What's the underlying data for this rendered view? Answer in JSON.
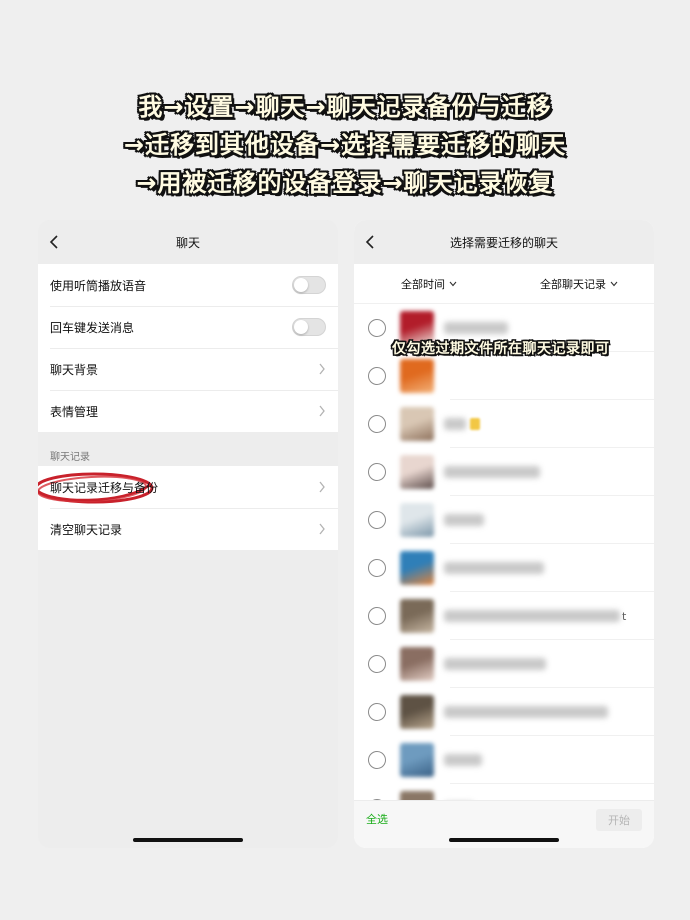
{
  "caption": {
    "line1": "我→设置→聊天→聊天记录备份与迁移",
    "line2": "→迁移到其他设备→选择需要迁移的聊天",
    "line3": "→用被迁移的设备登录→聊天记录恢复"
  },
  "left_screen": {
    "nav_title": "聊天",
    "settings": [
      {
        "label": "使用听筒播放语音",
        "control": "toggle",
        "on": false
      },
      {
        "label": "回车键发送消息",
        "control": "toggle",
        "on": false
      },
      {
        "label": "聊天背景",
        "control": "chevron"
      },
      {
        "label": "表情管理",
        "control": "chevron"
      }
    ],
    "section_label": "聊天记录",
    "records": [
      {
        "label": "聊天记录迁移与备份",
        "control": "chevron",
        "highlighted": true
      },
      {
        "label": "清空聊天记录",
        "control": "chevron"
      }
    ]
  },
  "right_screen": {
    "nav_title": "选择需要迁移的聊天",
    "filters": {
      "time": "全部时间",
      "records": "全部聊天记录"
    },
    "annotation": "仅勾选过期文件所在聊天记录即可",
    "chats": [
      {
        "avatar_colors": [
          "#b21d2a",
          "#efe6e0"
        ],
        "name_width": 64
      },
      {
        "avatar_colors": [
          "#e06a1f",
          "#f3b27a"
        ],
        "name_width": 0
      },
      {
        "avatar_colors": [
          "#d9c7b4",
          "#8c6f5a"
        ],
        "name_width": 22,
        "badge": true
      },
      {
        "avatar_colors": [
          "#e8d6cf",
          "#5a4a48"
        ],
        "name_width": 96
      },
      {
        "avatar_colors": [
          "#dfe6ea",
          "#7a95a8"
        ],
        "name_width": 40
      },
      {
        "avatar_colors": [
          "#2f7fb8",
          "#e2833a"
        ],
        "name_width": 100
      },
      {
        "avatar_colors": [
          "#7a6a58",
          "#c8b8a4"
        ],
        "name_width": 176,
        "suffix": "t"
      },
      {
        "avatar_colors": [
          "#8a6e62",
          "#e4cfc6"
        ],
        "name_width": 102
      },
      {
        "avatar_colors": [
          "#5e5244",
          "#b9a78f"
        ],
        "name_width": 164
      },
      {
        "avatar_colors": [
          "#6e9bbf",
          "#3a6186"
        ],
        "name_width": 38
      },
      {
        "avatar_colors": [
          "#8a7766",
          "#c4b3a2"
        ],
        "name_width": 30
      }
    ],
    "select_all": "全选",
    "start_button": "开始"
  }
}
